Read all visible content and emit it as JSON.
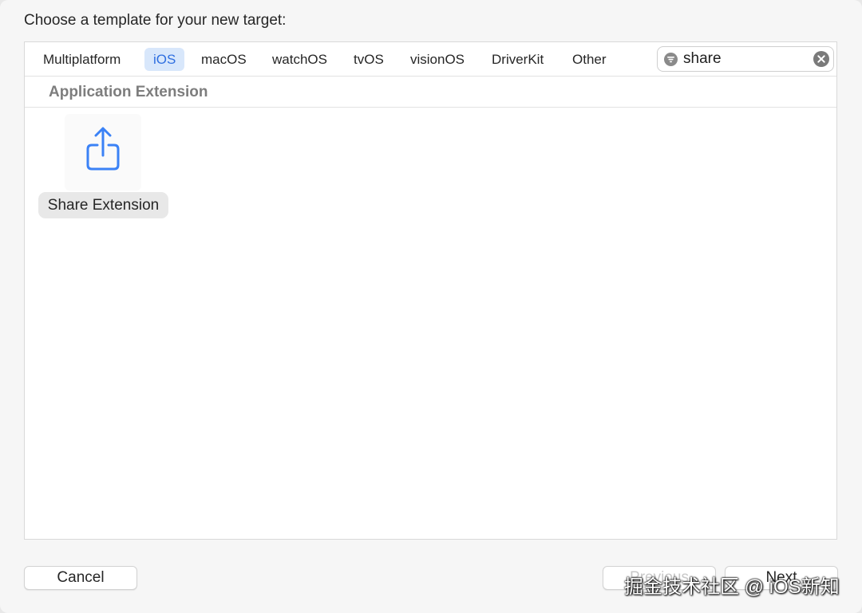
{
  "prompt": "Choose a template for your new target:",
  "tabs": [
    {
      "label": "Multiplatform",
      "selected": false
    },
    {
      "label": "iOS",
      "selected": true
    },
    {
      "label": "macOS",
      "selected": false
    },
    {
      "label": "watchOS",
      "selected": false
    },
    {
      "label": "tvOS",
      "selected": false
    },
    {
      "label": "visionOS",
      "selected": false
    },
    {
      "label": "DriverKit",
      "selected": false
    },
    {
      "label": "Other",
      "selected": false
    }
  ],
  "search": {
    "value": "share",
    "filter_icon": "filter-icon",
    "clear_icon": "clear-icon"
  },
  "section": {
    "title": "Application Extension"
  },
  "templates": [
    {
      "label": "Share Extension",
      "icon": "share-icon"
    }
  ],
  "buttons": {
    "cancel": "Cancel",
    "previous": "Previous",
    "next": "Next"
  },
  "watermark": "掘金技术社区 @ iOS新知",
  "colors": {
    "accent": "#2f6fe0",
    "selected_tab_bg": "#d8e7fb",
    "icon_blue": "#3b82f6"
  }
}
